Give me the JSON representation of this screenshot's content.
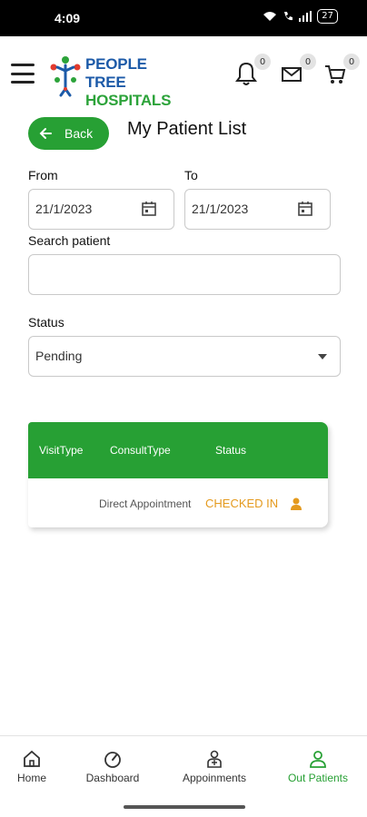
{
  "status_bar": {
    "time": "4:09",
    "battery": "27"
  },
  "brand": {
    "line1": "PEOPLE TREE",
    "line2": "HOSPITALS"
  },
  "header_icons": {
    "notifications_count": "0",
    "messages_count": "0",
    "cart_count": "0"
  },
  "page": {
    "back_label": "Back",
    "title": "My Patient List"
  },
  "filters": {
    "from_label": "From",
    "from_value": "21/1/2023",
    "to_label": "To",
    "to_value": "21/1/2023",
    "search_label": "Search patient",
    "search_value": "",
    "status_label": "Status",
    "status_selected": "Pending"
  },
  "table": {
    "columns": [
      "VisitType",
      "ConsultType",
      "Status"
    ],
    "rows": [
      {
        "visit_type": "",
        "consult_type": "Direct Appointment",
        "status": "CHECKED IN"
      }
    ]
  },
  "bottom_nav": {
    "items": [
      {
        "label": "Home",
        "icon": "home-icon"
      },
      {
        "label": "Dashboard",
        "icon": "dashboard-icon"
      },
      {
        "label": "Appoinments",
        "icon": "appointments-icon"
      },
      {
        "label": "Out Patients",
        "icon": "out-patients-icon"
      }
    ]
  },
  "colors": {
    "primary_green": "#27a034",
    "brand_blue": "#1c5aa8",
    "status_orange": "#e49a1e"
  }
}
